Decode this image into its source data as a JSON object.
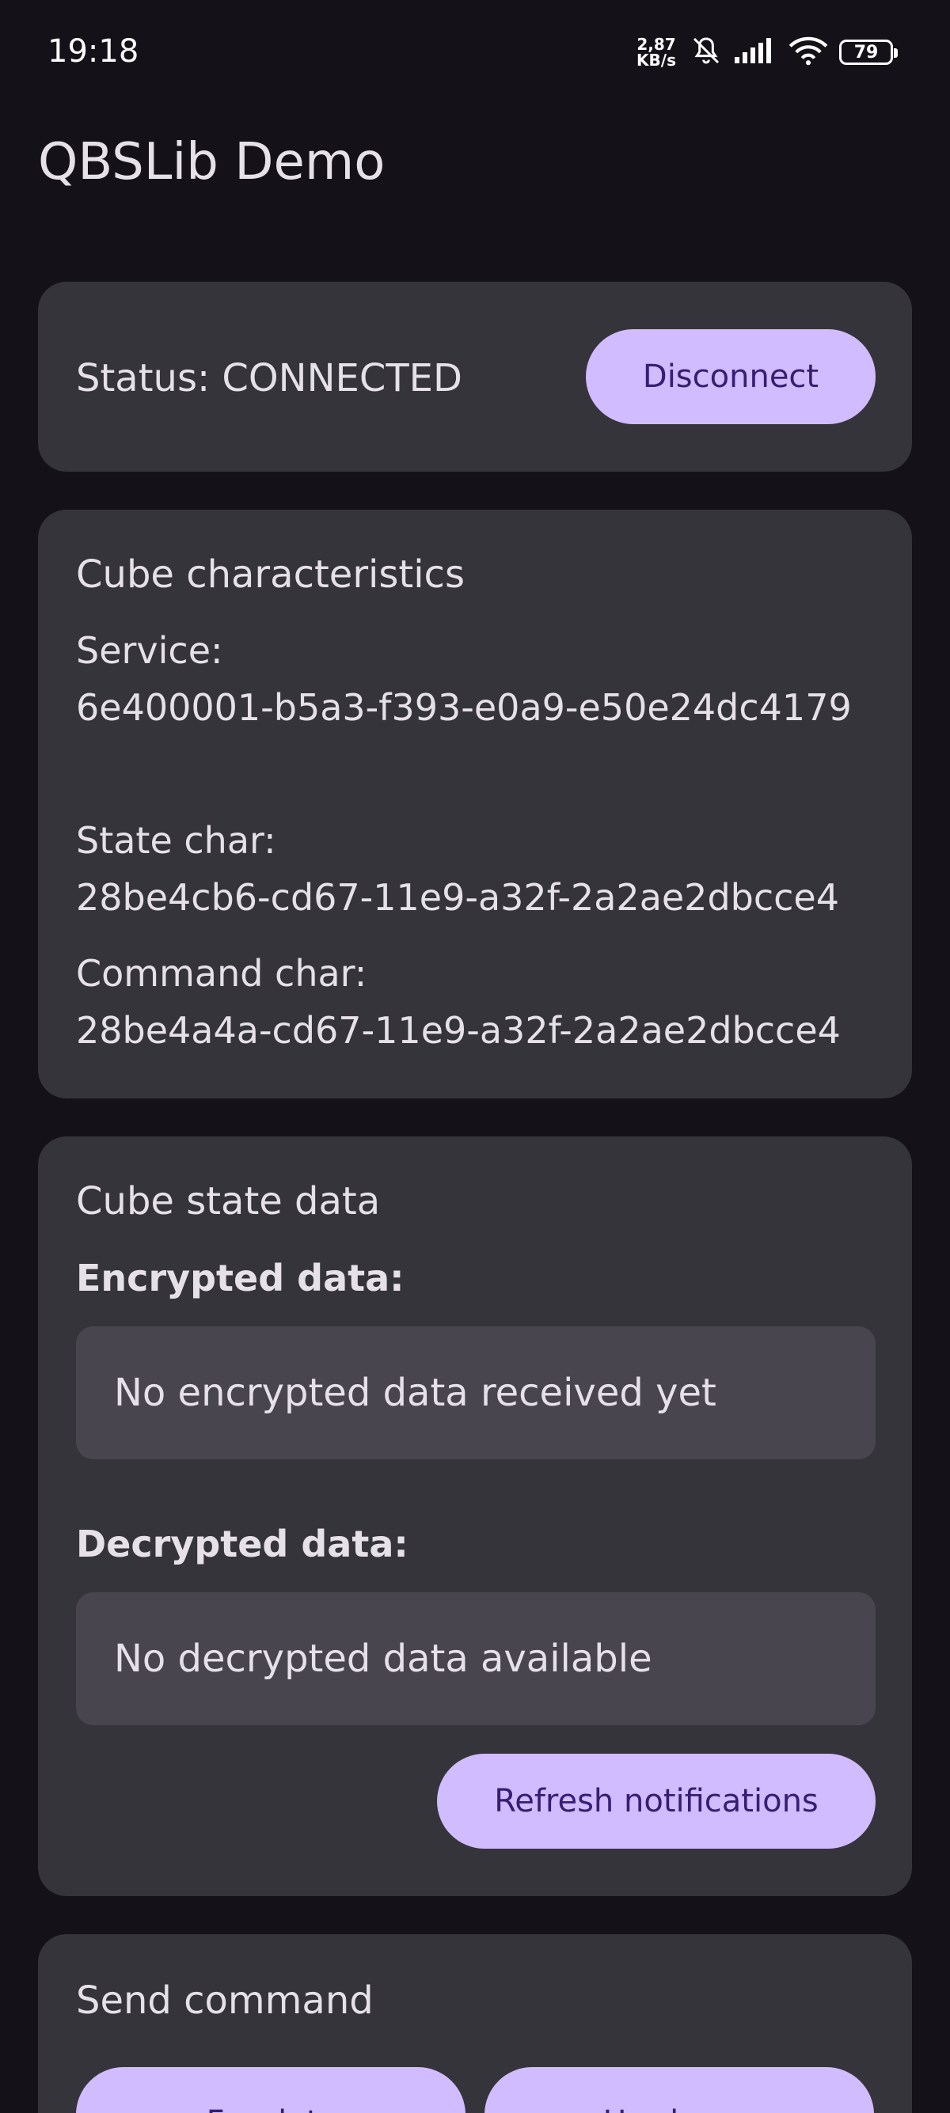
{
  "status_bar": {
    "time": "19:18",
    "net_speed_value": "2,87",
    "net_speed_unit": "KB/s",
    "battery": "79",
    "icons": [
      "bell-off-icon",
      "signal-icon",
      "wifi-icon",
      "battery-icon"
    ]
  },
  "app": {
    "title": "QBSLib Demo"
  },
  "status_card": {
    "status_text": "Status: CONNECTED",
    "disconnect_label": "Disconnect"
  },
  "characteristics": {
    "title": "Cube characteristics",
    "service_label": "Service:",
    "service_value": "6e400001-b5a3-f393-e0a9-e50e24dc4179",
    "state_label": "State char:",
    "state_value": "28be4cb6-cd67-11e9-a32f-2a2ae2dbcce4",
    "command_label": "Command char:",
    "command_value": "28be4a4a-cd67-11e9-a32f-2a2ae2dbcce4"
  },
  "state_data": {
    "title": "Cube state data",
    "encrypted_label": "Encrypted data:",
    "encrypted_value": "No encrypted data received yet",
    "decrypted_label": "Decrypted data:",
    "decrypted_value": "No decrypted data available",
    "refresh_label": "Refresh notifications"
  },
  "send_command": {
    "title": "Send command",
    "facelets_label": "Facelets",
    "hardware_label": "Hardware"
  },
  "colors": {
    "background": "#141218",
    "card": "#36343B",
    "field": "#49454F",
    "accent": "#D0BCFF",
    "on_accent": "#381E72",
    "text": "#E6E0E9"
  }
}
